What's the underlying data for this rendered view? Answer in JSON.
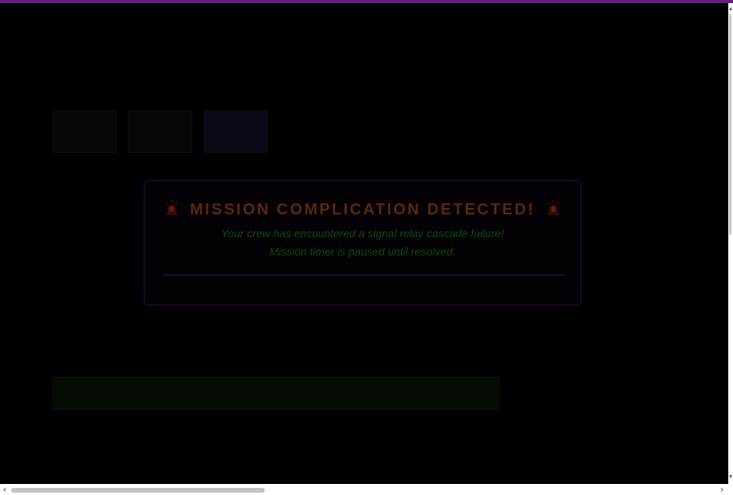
{
  "modal": {
    "title": "MISSION COMPLICATION DETECTED!",
    "message_line1": "Your crew has encountered a signal relay cascade failure!",
    "message_line2": "Mission timer is paused until resolved.",
    "icon_left": "siren-icon",
    "icon_right": "siren-icon"
  },
  "colors": {
    "overlay": "#000000",
    "top_accent": "#6b1a8a",
    "title": "#5a2a05",
    "message": "#0b4d0b",
    "divider": "#1c0a24"
  },
  "scrollbars": {
    "vertical": "scrollbar-vertical",
    "horizontal": "scrollbar-horizontal"
  }
}
